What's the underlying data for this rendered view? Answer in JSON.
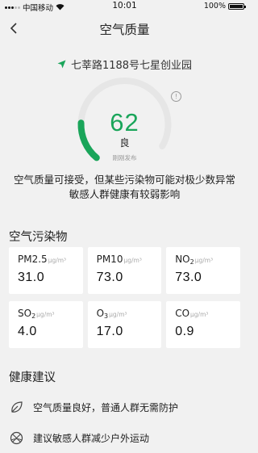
{
  "status_bar": {
    "carrier": "中国移动",
    "time": "10:01",
    "battery": "100%"
  },
  "nav": {
    "title": "空气质量"
  },
  "location": {
    "name": "七莘路1188号七星创业园"
  },
  "aqi": {
    "value": "62",
    "level": "良",
    "publish_status": "刚刚发布",
    "info": "!",
    "fraction": 0.2,
    "color": "#1aa55a",
    "track_color": "#e6e6e6"
  },
  "description": {
    "line1": "空气质量可接受，但某些污染物可能对极少数异常",
    "line2": "敏感人群健康有较弱影响"
  },
  "pollutants": {
    "title": "空气污染物",
    "items": [
      {
        "name": "PM2.5",
        "sub": "",
        "unit": "μg/m³",
        "value": "31.0"
      },
      {
        "name": "PM10",
        "sub": "",
        "unit": "μg/m³",
        "value": "73.0"
      },
      {
        "name": "NO",
        "sub": "2",
        "unit": "μg/m³",
        "value": "73.0"
      },
      {
        "name": "SO",
        "sub": "2",
        "unit": "μg/m³",
        "value": "4.0"
      },
      {
        "name": "O",
        "sub": "3",
        "unit": "μg/m³",
        "value": "17.0"
      },
      {
        "name": "CO",
        "sub": "",
        "unit": "μg/m³",
        "value": "0.9"
      }
    ]
  },
  "advice": {
    "title": "健康建议",
    "items": [
      {
        "icon": "leaf-icon",
        "text": "空气质量良好，普通人群无需防护"
      },
      {
        "icon": "basketball-icon",
        "text": "建议敏感人群减少户外运动"
      }
    ]
  }
}
